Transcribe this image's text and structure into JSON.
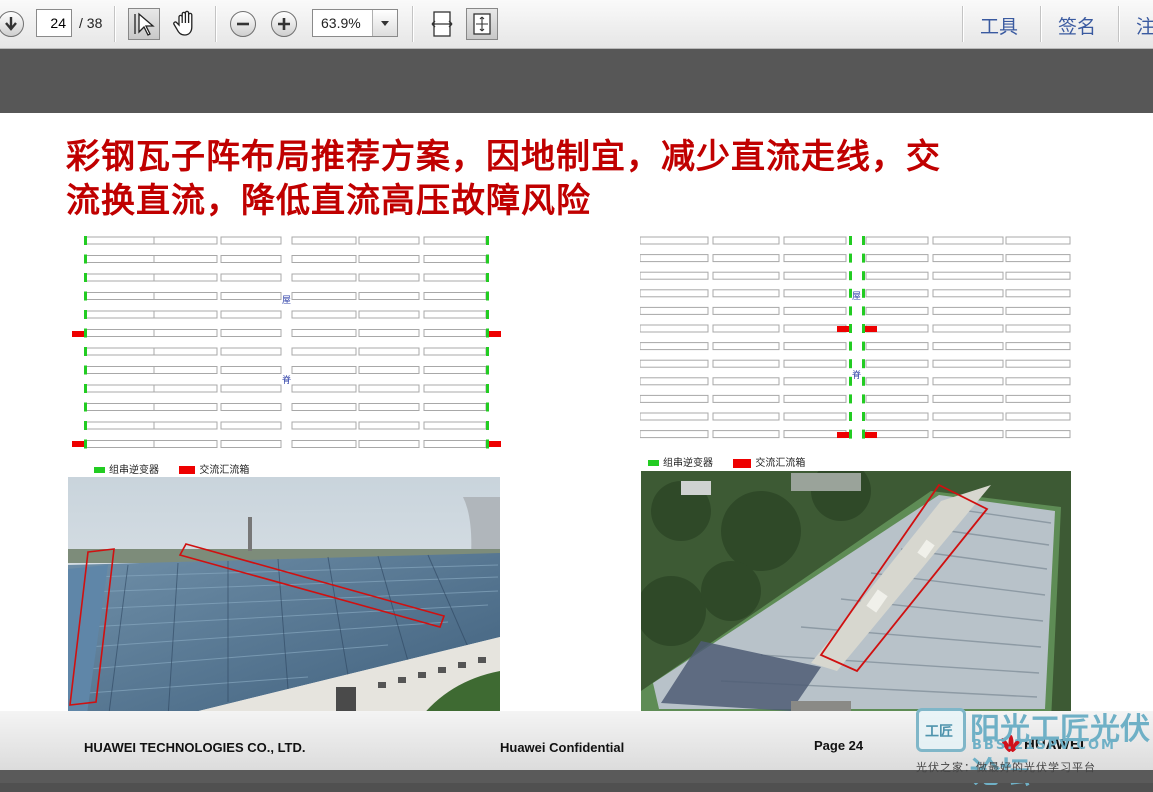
{
  "toolbar": {
    "current_page": "24",
    "total_pages": "/ 38",
    "zoom_value": "63.9%",
    "tools_label": "工具",
    "sign_label": "签名",
    "comment_label": "注"
  },
  "slide": {
    "title_line1": "彩钢瓦子阵布局推荐方案，因地制宜，减少直流走线，交",
    "title_line2": "流换直流，降低直流高压故障风险",
    "left_diagram": {
      "ridge_char_top": "屋",
      "ridge_char_bottom": "脊",
      "legend_inverter": "组串逆变器",
      "legend_combiner": "交流汇流箱"
    },
    "right_diagram": {
      "ridge_char_top": "屋",
      "ridge_char_bottom": "脊",
      "legend_inverter": "组串逆变器",
      "legend_combiner": "交流汇流箱"
    },
    "footer_company": "HUAWEI TECHNOLOGIES CO., LTD.",
    "footer_confidential": "Huawei Confidential",
    "footer_page": "Page 24",
    "footer_brand": "HUAWEI"
  },
  "watermark": {
    "logo_text": "阳光工匠光伏论坛",
    "logo_badge": "工匠",
    "logo_sub": "BBS.21SPV.COM",
    "tagline": "光伏之家：做最好的光伏学习平台"
  },
  "colors": {
    "title_red": "#c00000",
    "inverter_green": "#22cc22",
    "combiner_red": "#ee0000",
    "highlight_red": "#d01010"
  }
}
